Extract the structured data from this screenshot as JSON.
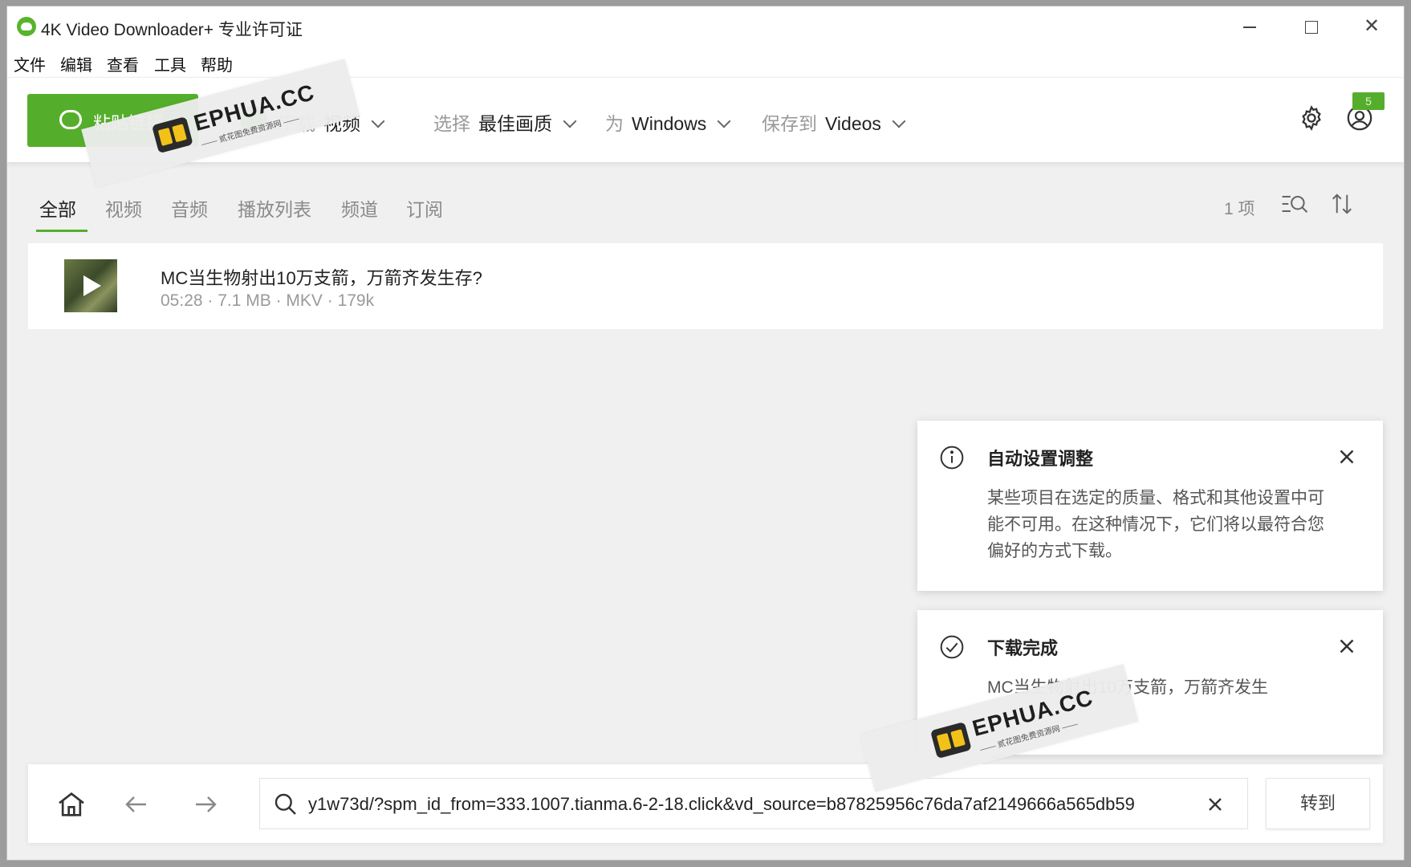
{
  "titlebar": {
    "title": "4K Video Downloader+ 专业许可证",
    "minimize": "",
    "maximize": "",
    "close": "✕"
  },
  "menu": [
    "文件",
    "编辑",
    "查看",
    "工具",
    "帮助"
  ],
  "toolbar": {
    "paste_label": "粘贴链接",
    "download_label": "下载",
    "download_value": "视频",
    "quality_label": "选择",
    "quality_value": "最佳画质",
    "platform_label": "为",
    "platform_value": "Windows",
    "save_label": "保存到",
    "save_value": "Videos",
    "account_badge": "5"
  },
  "tabs": [
    "全部",
    "视频",
    "音频",
    "播放列表",
    "频道",
    "订阅"
  ],
  "item_count": "1 项",
  "downloads": [
    {
      "title": "MC当生物射出10万支箭，万箭齐发生存?",
      "meta": "05:28 · 7.1 MB · MKV · 179k"
    }
  ],
  "toasts": [
    {
      "title": "自动设置调整",
      "body": "某些项目在选定的质量、格式和其他设置中可能不可用。在这种情况下，它们将以最符合您偏好的方式下载。"
    },
    {
      "title": "下载完成",
      "body": "MC当生物射出10万支箭，万箭齐发生"
    }
  ],
  "navbar": {
    "url_value": "y1w73d/?spm_id_from=333.1007.tianma.6-2-18.click&vd_source=b87825956c76da7af2149666a565db59",
    "go_label": "转到"
  },
  "watermark": {
    "text": "EPHUA.CC",
    "sub": "—— 贰花图免费资源网 ——"
  },
  "colors": {
    "accent": "#55ae2b",
    "background": "#f0f0f0"
  }
}
